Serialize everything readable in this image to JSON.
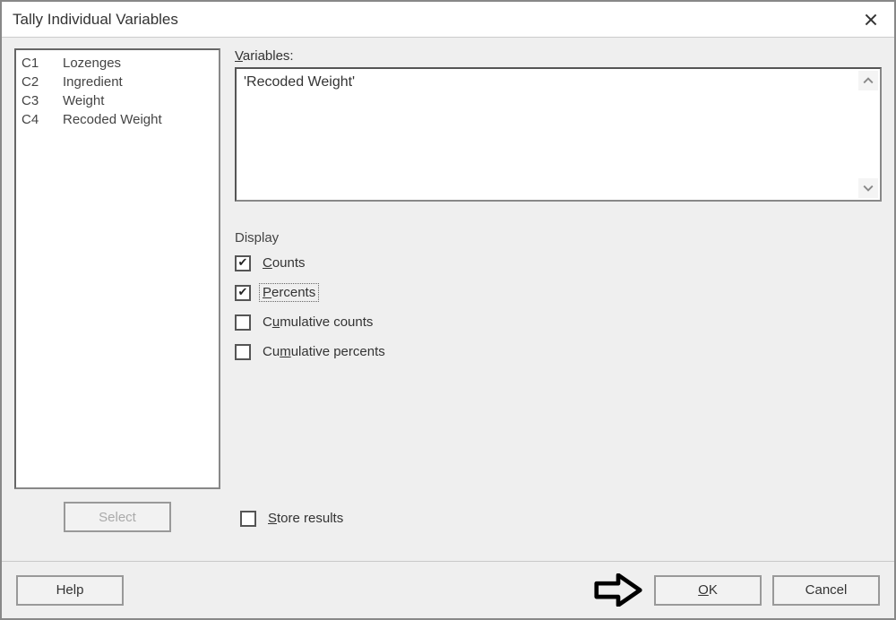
{
  "window": {
    "title": "Tally Individual Variables"
  },
  "columns_list": [
    {
      "id": "C1",
      "name": "Lozenges"
    },
    {
      "id": "C2",
      "name": "Ingredient"
    },
    {
      "id": "C3",
      "name": "Weight"
    },
    {
      "id": "C4",
      "name": "Recoded Weight"
    }
  ],
  "select_button": {
    "label": "Select",
    "enabled": false
  },
  "variables": {
    "label": "Variables:",
    "value": "'Recoded Weight'"
  },
  "display": {
    "label": "Display",
    "options": {
      "counts": {
        "label": "Counts",
        "checked": true
      },
      "percents": {
        "label": "Percents",
        "checked": true,
        "focused": true
      },
      "cum_counts": {
        "label": "Cumulative counts",
        "checked": false
      },
      "cum_percents": {
        "label": "Cumulative percents",
        "checked": false
      }
    }
  },
  "store_results": {
    "label": "Store results",
    "checked": false
  },
  "buttons": {
    "help": "Help",
    "ok": "OK",
    "cancel": "Cancel"
  }
}
